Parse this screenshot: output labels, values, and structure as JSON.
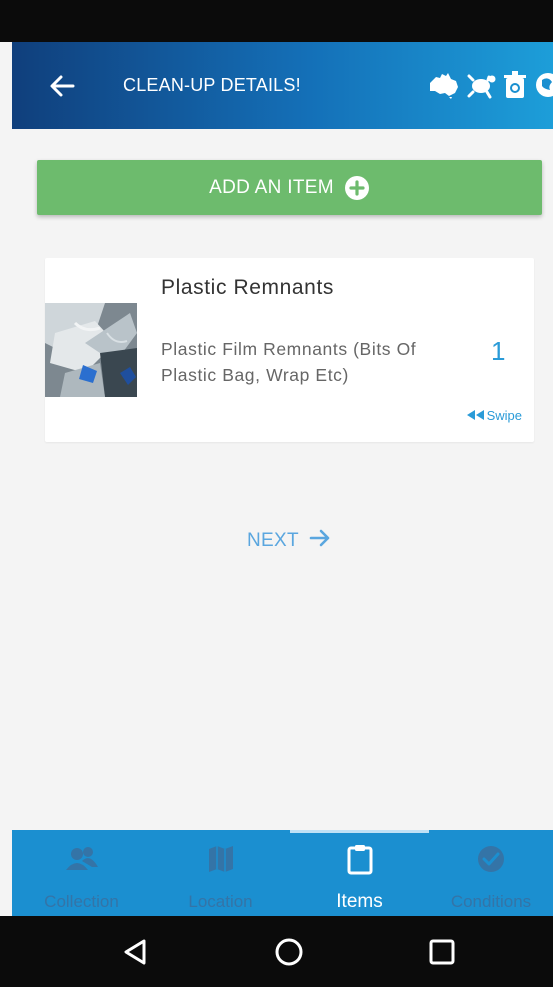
{
  "app_bar": {
    "title": "CLEAN-UP DETAILS!",
    "icons": [
      "australia-map-icon",
      "turtle-icon",
      "recycle-bin-icon",
      "globe-icon"
    ]
  },
  "add_item": {
    "label": "ADD AN ITEM",
    "icon": "plus-circle-icon"
  },
  "items": [
    {
      "title": "Plastic Remnants",
      "description_line1": "Plastic Film Remnants (Bits Of",
      "description_line2": "Plastic Bag, Wrap Etc)",
      "quantity": "1",
      "swipe_label": "Swipe",
      "swipe_icon": "double-left-arrow-icon"
    }
  ],
  "next": {
    "label": "NEXT",
    "icon": "arrow-right-icon"
  },
  "bottom_nav": {
    "items": [
      {
        "label": "Collection",
        "icon": "people-icon",
        "active": false
      },
      {
        "label": "Location",
        "icon": "map-icon",
        "active": false
      },
      {
        "label": "Items",
        "icon": "clipboard-icon",
        "active": true
      },
      {
        "label": "Conditions",
        "icon": "check-circle-icon",
        "active": false
      }
    ]
  },
  "colors": {
    "app_bar_start": "#103f7c",
    "app_bar_end": "#1d9ed9",
    "add_button": "#6dbb6d",
    "accent": "#2a9bd8",
    "bottom_nav": "#1b8fd0",
    "nav_inactive": "#3474a7"
  }
}
